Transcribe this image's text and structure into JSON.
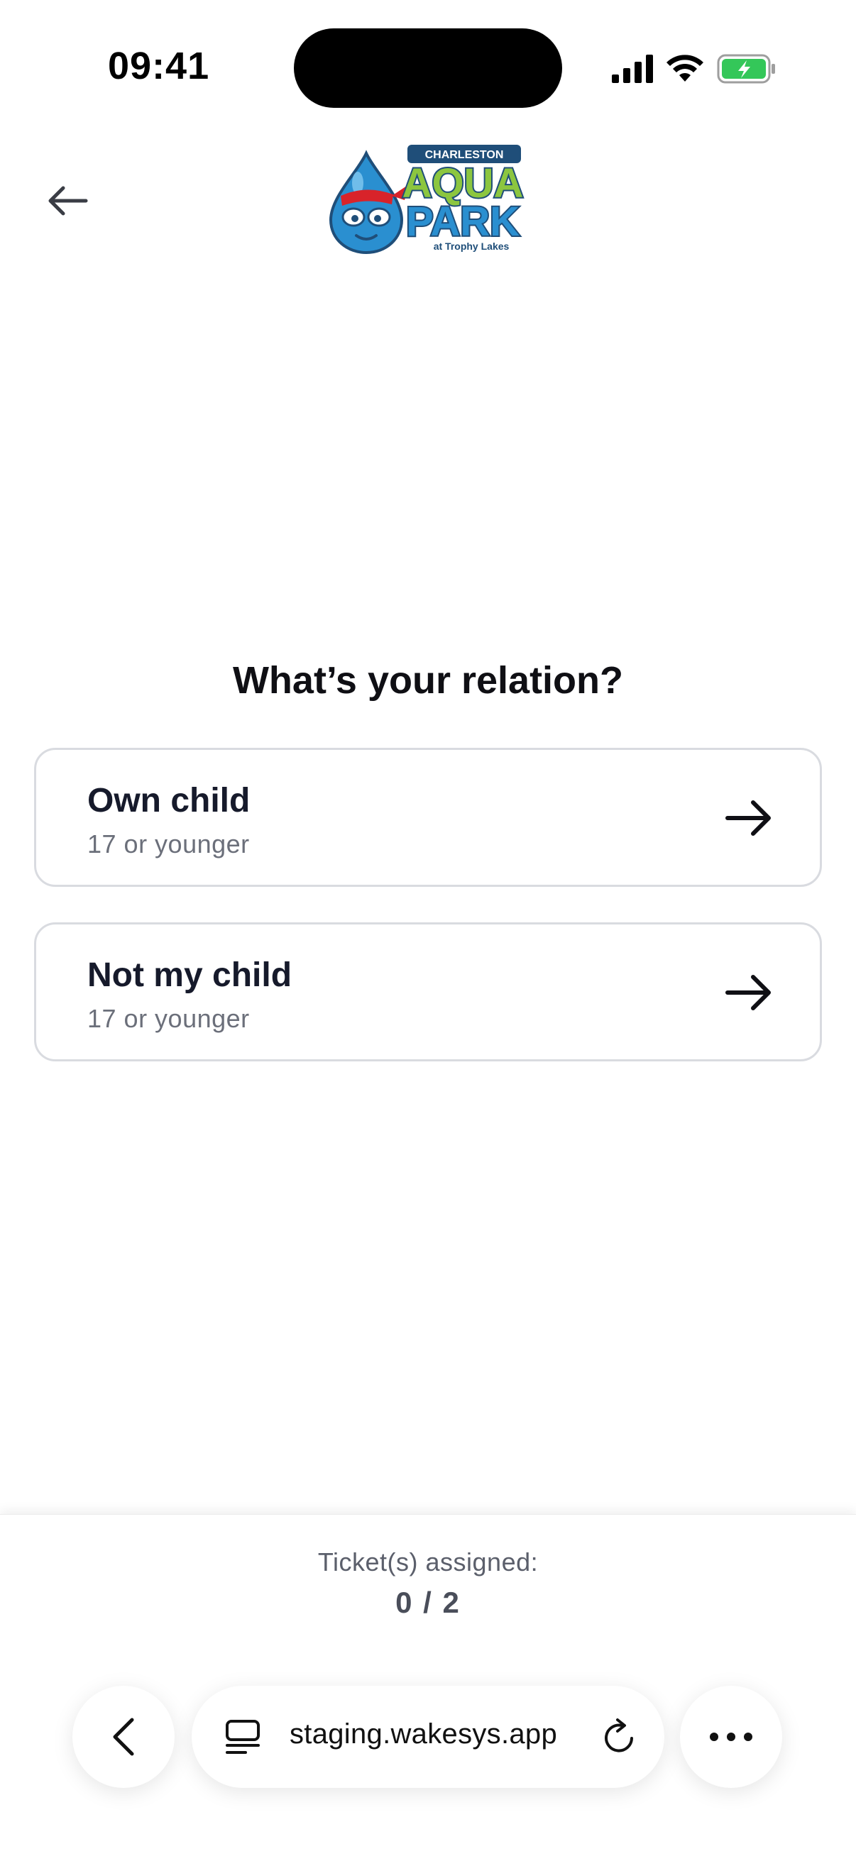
{
  "status_bar": {
    "time": "09:41"
  },
  "header": {
    "logo": {
      "top_text": "CHARLESTON",
      "line1": "AQUA",
      "line2": "PARK",
      "bottom_text": "at Trophy Lakes",
      "colors": {
        "green": "#8cc63f",
        "blue": "#2a8fd0",
        "dark_blue": "#1f4e79",
        "bandana_red": "#d8232a"
      }
    }
  },
  "main": {
    "question": "What’s your relation?",
    "options": [
      {
        "title": "Own child",
        "subtitle": "17 or younger"
      },
      {
        "title": "Not my child",
        "subtitle": "17 or younger"
      }
    ]
  },
  "footer": {
    "tickets_label": "Ticket(s) assigned:",
    "tickets_count": "0 / 2"
  },
  "browser": {
    "url": "staging.wakesys.app"
  },
  "colors": {
    "card_border": "#d9dbe0",
    "text_primary": "#161a2b",
    "text_secondary": "#6b6f7a",
    "battery_green": "#34c759"
  }
}
